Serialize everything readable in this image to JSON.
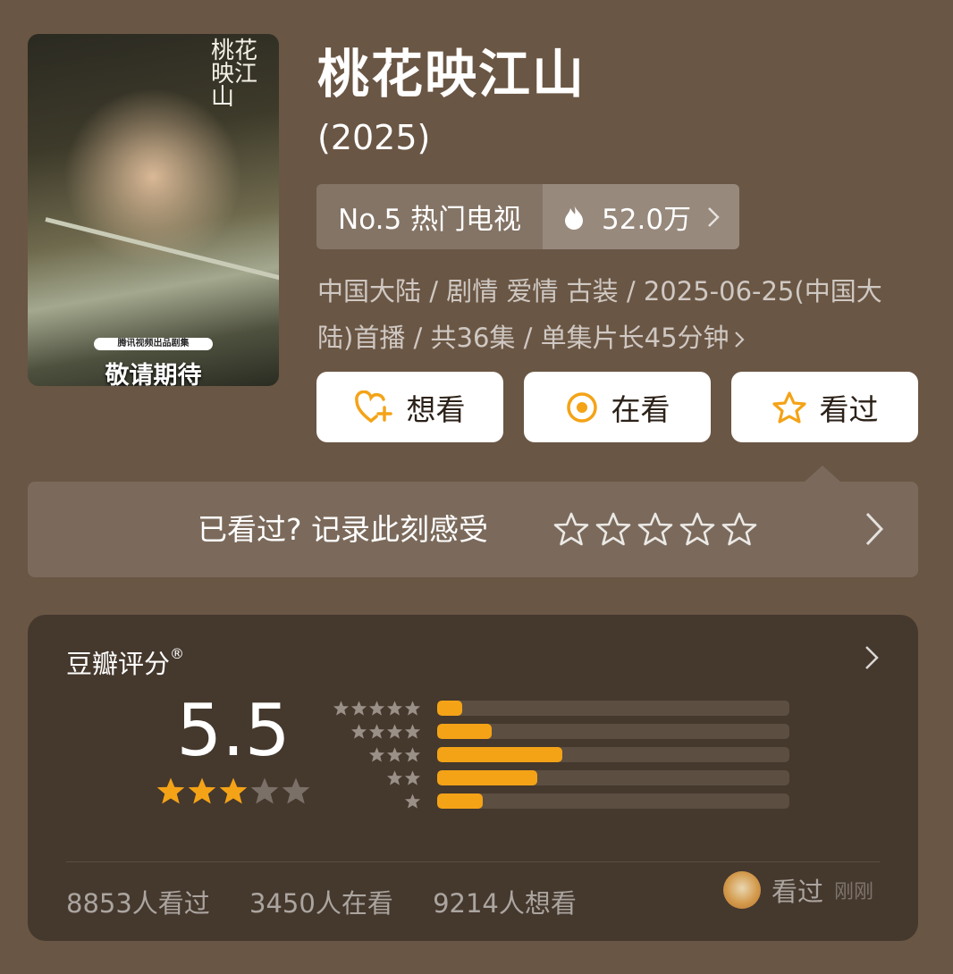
{
  "poster": {
    "calligraphy": "桃花映江山",
    "band_text": "腾讯视频出品剧集",
    "promo_text": "敬请期待"
  },
  "header": {
    "title": "桃花映江山",
    "year": "(2025)"
  },
  "rank": {
    "label": "No.5 热门电视",
    "heat": "52.0万"
  },
  "meta": {
    "line1": "中国大陆 / 剧情 爱情 古装 / 2025-06-25(中国大",
    "line2": "陆)首播 / 共36集 / 单集片长45分钟"
  },
  "actions": {
    "want_label": "想看",
    "watching_label": "在看",
    "watched_label": "看过"
  },
  "record": {
    "prompt": "已看过? 记录此刻感受",
    "star_count": 5
  },
  "rating": {
    "label": "豆瓣评分",
    "registered": "®",
    "score": "5.5",
    "star_level": 3,
    "distribution": [
      {
        "stars": 5,
        "fraction": 0.07
      },
      {
        "stars": 4,
        "fraction": 0.155
      },
      {
        "stars": 3,
        "fraction": 0.355
      },
      {
        "stars": 2,
        "fraction": 0.285
      },
      {
        "stars": 1,
        "fraction": 0.13
      }
    ],
    "counts": {
      "watched": "8853人看过",
      "watching": "3450人在看",
      "want": "9214人想看"
    },
    "activity": {
      "label": "看过",
      "time": "刚刚"
    }
  },
  "colors": {
    "background": "#6a5644",
    "card": "#45382d",
    "accent": "#f4a317",
    "button_text": "#2c2118"
  }
}
